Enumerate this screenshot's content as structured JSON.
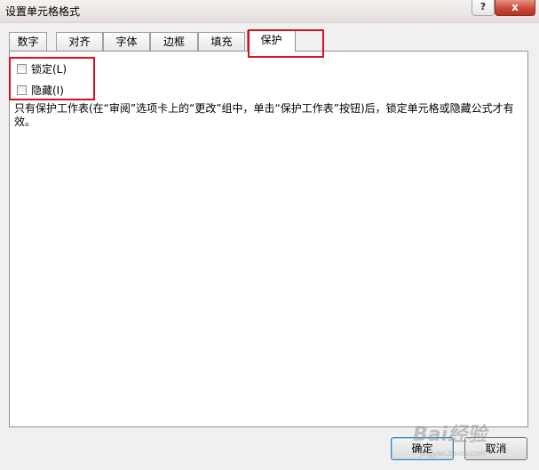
{
  "window": {
    "title": "设置单元格格式"
  },
  "titlebar": {
    "help_label": "?",
    "close_label": "x"
  },
  "tabs": [
    {
      "label": "数字"
    },
    {
      "label": "对齐"
    },
    {
      "label": "字体"
    },
    {
      "label": "边框"
    },
    {
      "label": "填充"
    },
    {
      "label": "保护"
    }
  ],
  "active_tab": "保护",
  "protection": {
    "locked": {
      "label": "锁定(L)",
      "checked": false
    },
    "hidden": {
      "label": "隐藏(I)",
      "checked": false
    },
    "description": "只有保护工作表(在“审阅”选项卡上的“更改”组中，单击“保护工作表”按钮)后，锁定单元格或隐藏公式才有效。"
  },
  "buttons": {
    "ok": "确定",
    "cancel": "取消"
  },
  "watermark": {
    "text": "Bai经验",
    "sub": "jingyan.baidu.com"
  },
  "colors": {
    "highlight": "#d9101e"
  }
}
